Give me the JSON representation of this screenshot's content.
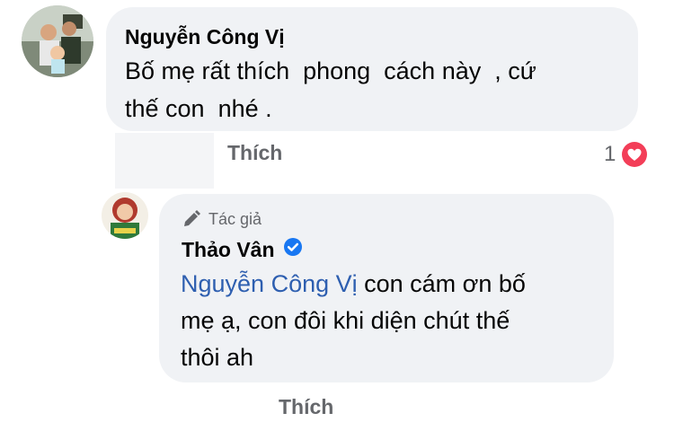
{
  "comment": {
    "author": "Nguyễn Công Vị",
    "text": "Bố mẹ rất thích  phong  cách này  , cứ\nthế con  nhé .",
    "like_label": "Thích",
    "reaction_count": "1",
    "reaction_icon": "heart-icon"
  },
  "reply": {
    "badge": "Tác giả",
    "badge_icon": "pencil-icon",
    "author": "Thảo Vân",
    "verified_icon": "verified-check-icon",
    "mention": "Nguyễn Công Vị",
    "text": " con cám ơn bố\nmẹ ạ, con đôi khi diện chút thế\nthôi ah",
    "like_label": "Thích"
  },
  "colors": {
    "bubble": "#f0f2f5",
    "mention": "#2e5fb0",
    "verified": "#1877f2",
    "heart": "#f33e58",
    "secondary_text": "#65676b"
  }
}
